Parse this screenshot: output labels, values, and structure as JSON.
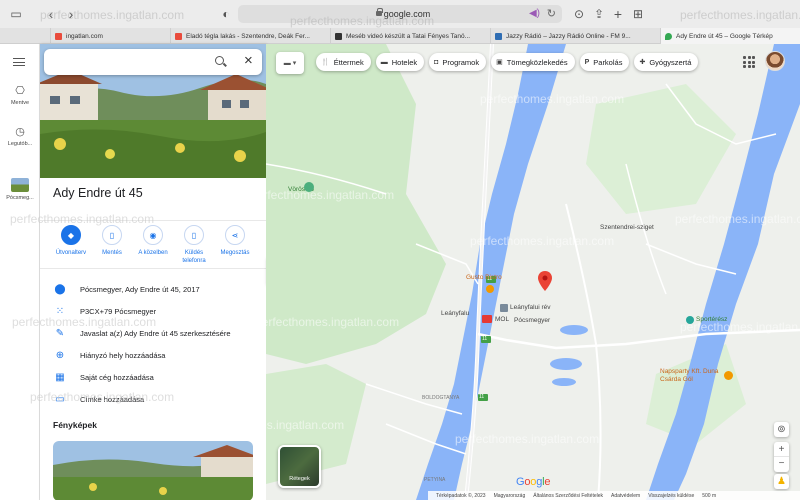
{
  "browser": {
    "url": "google.com",
    "icons": [
      "sidebar-icon",
      "back-icon",
      "forward-icon",
      "shield-icon",
      "lock-icon",
      "speaker-icon",
      "reload-icon",
      "download-icon",
      "share-icon",
      "new-tab-icon",
      "tab-overview-icon"
    ]
  },
  "tabs": [
    {
      "label": "ingatlan.com",
      "favicon_color": "#e94b3c"
    },
    {
      "label": "Eladó tégla lakás - Szentendre, Deák Fer...",
      "favicon_color": "#e94b3c"
    },
    {
      "label": "Meséb videó készült a Tatai Fényes Tanö...",
      "favicon_color": "#333333"
    },
    {
      "label": "Jazzy Rádió – Jazzy Rádió Online - FM 9...",
      "favicon_color": "#2f6db3"
    },
    {
      "label": "Ady Endre út 45 – Google Térkép",
      "favicon_color": "#34a853"
    }
  ],
  "rail": {
    "saved": "Mentve",
    "recent": "Legutób...",
    "place": "Pócsmeg..."
  },
  "panel": {
    "title": "Ady Endre út 45",
    "actions": [
      {
        "label": "Útvonalterv",
        "icon": "directions-icon"
      },
      {
        "label": "Mentés",
        "icon": "bookmark-icon"
      },
      {
        "label": "A közelben",
        "icon": "nearby-icon"
      },
      {
        "label": "Küldés telefonra",
        "icon": "send-to-phone-icon"
      },
      {
        "label": "Megosztás",
        "icon": "share-icon"
      }
    ],
    "info": [
      {
        "text": "Pócsmegyer, Ady Endre út 45, 2017",
        "icon": "place-pin-icon"
      },
      {
        "text": "P3CX+79 Pócsmegyer",
        "icon": "plus-code-icon"
      },
      {
        "text": "Javaslat a(z) Ady Endre út 45 szerkesztésére",
        "icon": "pencil-icon"
      },
      {
        "text": "Hiányzó hely hozzáadása",
        "icon": "add-place-icon"
      },
      {
        "text": "Saját cég hozzáadása",
        "icon": "business-icon"
      },
      {
        "text": "Címke hozzáadása",
        "icon": "label-icon"
      }
    ],
    "photos_heading": "Fényképek"
  },
  "map": {
    "chips": [
      {
        "label": "Éttermek",
        "icon": "fork-knife-icon"
      },
      {
        "label": "Hotelek",
        "icon": "bed-icon"
      },
      {
        "label": "Programok",
        "icon": "camera-icon"
      },
      {
        "label": "Tömegközlekedés",
        "icon": "bus-icon"
      },
      {
        "label": "Parkolás",
        "icon": "parking-icon"
      },
      {
        "label": "Gyógyszertá",
        "icon": "pharmacy-icon"
      }
    ],
    "labels": {
      "voros_ko": "Vörös-kő",
      "szentendrei_sziget": "Szentendrei-sziget",
      "gusto": "Gusto Bistro",
      "leanyfalu": "Leányfalu",
      "leanyfalui_rev": "Leányfalui rév",
      "mol": "MOL",
      "pocsmegyer": "Pócsmegyer",
      "boldogtanya": "BOLDOGTANYA",
      "petyina": "PETYINA",
      "sporteresz": "Sportérész",
      "napsparty": "Napsparty Kft. Duna Csárda Gól",
      "road_11a": "11",
      "road_11b": "11",
      "road_11c": "11"
    },
    "layers_label": "Rétegek",
    "footer": [
      "Térképadatok ©, 2023",
      "Magyarország",
      "Általános Szerződési Feltételek",
      "Adatvédelem",
      "Visszajelzés küldése",
      "500 m"
    ],
    "colors": {
      "water": "#8ab4f8",
      "land": "#eef0ec",
      "green": "#c9e8c2",
      "accent": "#1a73e8",
      "pin": "#ea4335"
    }
  },
  "watermark": "perfecthomes.ingatlan.com"
}
